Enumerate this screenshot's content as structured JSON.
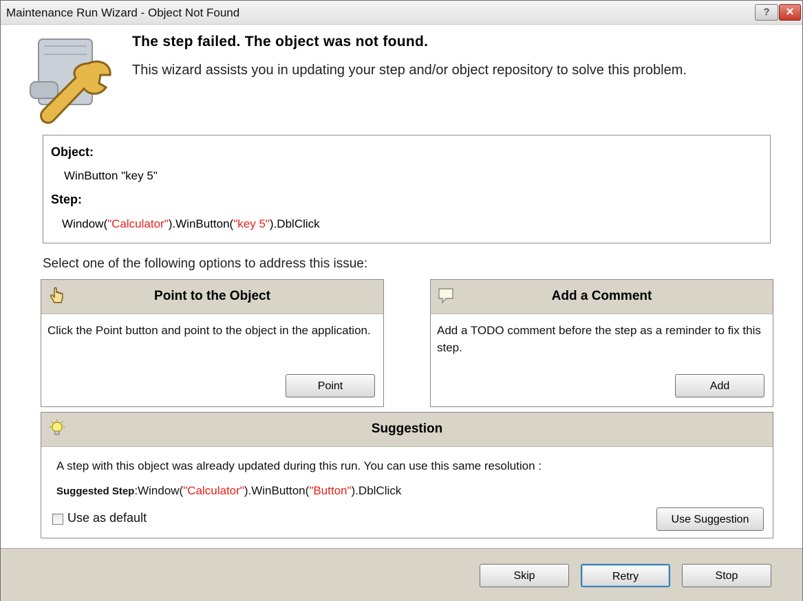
{
  "window": {
    "title": "Maintenance Run Wizard - Object Not Found",
    "help_label": "?",
    "close_label": "✕"
  },
  "header": {
    "title": "The step failed. The object was not found.",
    "description": "This wizard assists you in updating your step and/or object repository to solve this problem."
  },
  "info": {
    "object_label": "Object:",
    "object_value": "WinButton \"key 5\"",
    "step_label": "Step:",
    "step_parts": {
      "p1": "Window(",
      "p2": "\"Calculator\"",
      "p3": ").WinButton(",
      "p4": "\"key 5\"",
      "p5": ").DblClick"
    }
  },
  "select_prompt": "Select one of the following options to address this issue:",
  "point_panel": {
    "title": "Point to the Object",
    "body": "Click the Point button and point to the object in the application.",
    "button": "Point",
    "icon": "hand-pointer-icon"
  },
  "comment_panel": {
    "title": "Add a Comment",
    "body": "Add a TODO comment before the step as a reminder to fix this step.",
    "button": "Add",
    "icon": "comment-icon"
  },
  "suggestion_panel": {
    "title": "Suggestion",
    "icon": "lightbulb-icon",
    "message": "A step with this object was already updated during this run. You can use this same resolution :",
    "suggested_label": "Suggested Step",
    "suggested_parts": {
      "p1": ":Window(",
      "p2": "\"Calculator\"",
      "p3": ").WinButton(",
      "p4": "\"Button\"",
      "p5": ").DblClick"
    },
    "use_default_label": "Use as default",
    "use_default_checked": false,
    "button": "Use Suggestion"
  },
  "footer": {
    "skip": "Skip",
    "retry": "Retry",
    "stop": "Stop"
  },
  "colors": {
    "highlight_red": "#e2231a",
    "panel_header": "#d8d4c8"
  }
}
